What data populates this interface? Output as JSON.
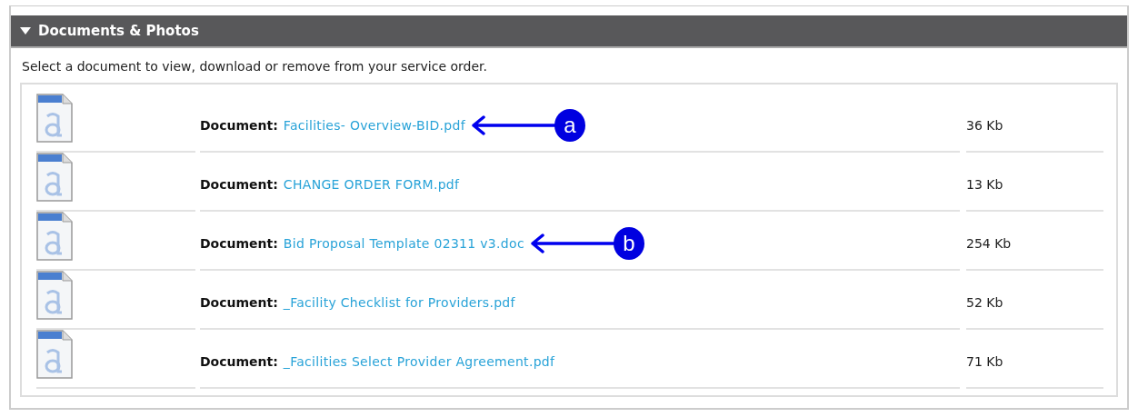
{
  "panel": {
    "title": "Documents & Photos",
    "expanded": true
  },
  "intro": "Select a document to view, download or remove from your service order.",
  "documents": [
    {
      "label": "Document:",
      "name": "Facilities- Overview-BID.pdf",
      "size": "36 Kb",
      "callout": "a"
    },
    {
      "label": "Document:",
      "name": "CHANGE ORDER FORM.pdf",
      "size": "13 Kb"
    },
    {
      "label": "Document:",
      "name": "Bid Proposal Template 02311 v3.doc",
      "size": "254 Kb",
      "callout": "b"
    },
    {
      "label": "Document:",
      "name": "_Facility Checklist for Providers.pdf",
      "size": "52 Kb"
    },
    {
      "label": "Document:",
      "name": "_Facilities Select Provider Agreement.pdf",
      "size": "71 Kb"
    }
  ]
}
